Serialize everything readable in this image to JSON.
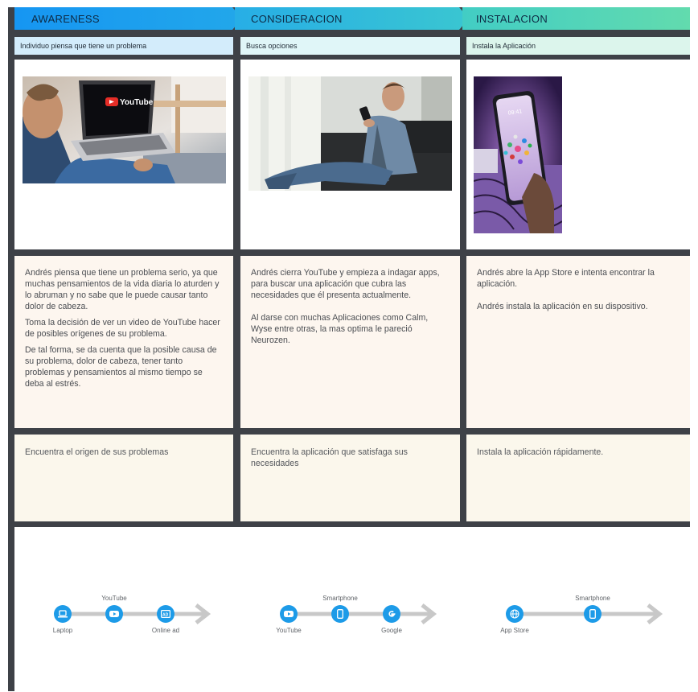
{
  "stages": [
    {
      "title": "AWARENESS",
      "subtitle": "Individuo piensa que tiene un problema",
      "photo_logo": "YouTube",
      "description": [
        "Andrés piensa que tiene un problema serio, ya que muchas pensamientos de la vida diaria lo aturden y lo abruman y no sabe que le puede causar tanto dolor de cabeza.",
        "Toma la decisión de ver un video de YouTube hacer de posibles orígenes de su problema.",
        "De tal forma, se da cuenta que la posible causa de su problema, dolor de cabeza, tener tanto problemas y pensamientos al mismo tiempo se deba al estrés."
      ],
      "goal": "Encuentra el origen de sus problemas",
      "channels": [
        {
          "label": "Laptop",
          "icon": "laptop-icon"
        },
        {
          "label": "YouTube",
          "icon": "youtube-icon"
        },
        {
          "label": "Online ad",
          "icon": "ad-icon"
        }
      ]
    },
    {
      "title": "CONSIDERACION",
      "subtitle": "Busca opciones",
      "description": [
        "Andrés cierra YouTube y empieza a indagar apps, para buscar una aplicación que cubra las necesidades que él presenta actualmente.",
        "Al darse con muchas Aplicaciones como Calm, Wyse entre otras, la mas optima le pareció Neurozen."
      ],
      "goal": "Encuentra la aplicación que satisfaga sus necesidades",
      "channels": [
        {
          "label": "YouTube",
          "icon": "youtube-icon"
        },
        {
          "label": "Smartphone",
          "icon": "smartphone-icon"
        },
        {
          "label": "Google",
          "icon": "google-icon"
        }
      ]
    },
    {
      "title": "INSTALACION",
      "subtitle": "Instala la Aplicación",
      "phone_time": "09:41",
      "description": [
        "Andrés  abre la App Store e intenta encontrar la aplicación.",
        "Andrés  instala la aplicación en su dispositivo."
      ],
      "goal": "Instala la aplicación rápidamente.",
      "channels": [
        {
          "label": "App Store",
          "icon": "globe-icon"
        },
        {
          "label": "Smartphone",
          "icon": "smartphone-icon"
        }
      ]
    }
  ],
  "colors": {
    "board": "#3e4147",
    "banner_awareness": "#1c9af0",
    "banner_consideracion": "#2ebcd6",
    "banner_instalacion": "#5bd6b2",
    "icon": "#1d9be8",
    "arrow": "#c8c8c8"
  }
}
